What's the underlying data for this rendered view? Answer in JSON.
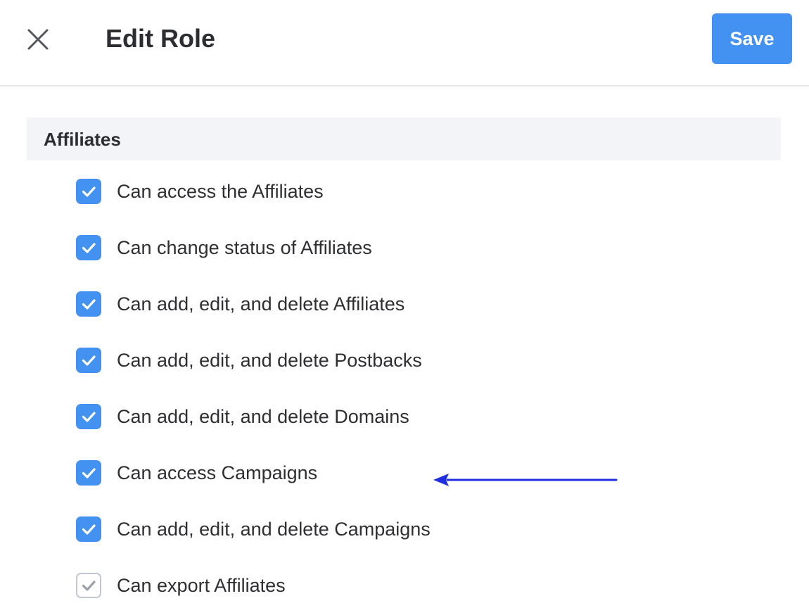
{
  "header": {
    "title": "Edit Role",
    "save_label": "Save"
  },
  "section": {
    "title": "Affiliates",
    "permissions": [
      {
        "label": "Can access the Affiliates",
        "checked": true
      },
      {
        "label": "Can change status of Affiliates",
        "checked": true
      },
      {
        "label": "Can add, edit, and delete Affiliates",
        "checked": true
      },
      {
        "label": "Can add, edit, and delete Postbacks",
        "checked": true
      },
      {
        "label": "Can add, edit, and delete Domains",
        "checked": true
      },
      {
        "label": "Can access Campaigns",
        "checked": true
      },
      {
        "label": "Can add, edit, and delete Campaigns",
        "checked": true
      },
      {
        "label": "Can export Affiliates",
        "checked": true,
        "disabled": true
      }
    ]
  },
  "icons": {
    "close": "close-icon",
    "check": "checkmark-icon",
    "annotation": "arrow-left-icon"
  },
  "colors": {
    "accent": "#4391f0",
    "annotation_arrow": "#1f2fe0",
    "disabled_check": "#9aa0a8"
  }
}
